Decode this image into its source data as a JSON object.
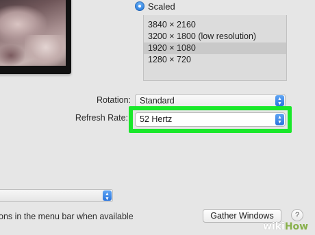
{
  "scaling": {
    "option_label": "Scaled",
    "resolutions": [
      "3840 × 2160",
      "3200 × 1800 (low resolution)",
      "1920 × 1080",
      "1280 × 720"
    ],
    "selected_index": 2
  },
  "rotation": {
    "label": "Rotation:",
    "value": "Standard"
  },
  "refresh_rate": {
    "label": "Refresh Rate:",
    "value": "52 Hertz"
  },
  "mirroring": {
    "option_text": "ons in the menu bar when available"
  },
  "buttons": {
    "gather_windows": "Gather Windows",
    "help": "?"
  },
  "watermark": {
    "part1": "wiki",
    "part2": "How"
  },
  "colors": {
    "highlight": "#19e82a",
    "accent": "#2d7fe0"
  }
}
